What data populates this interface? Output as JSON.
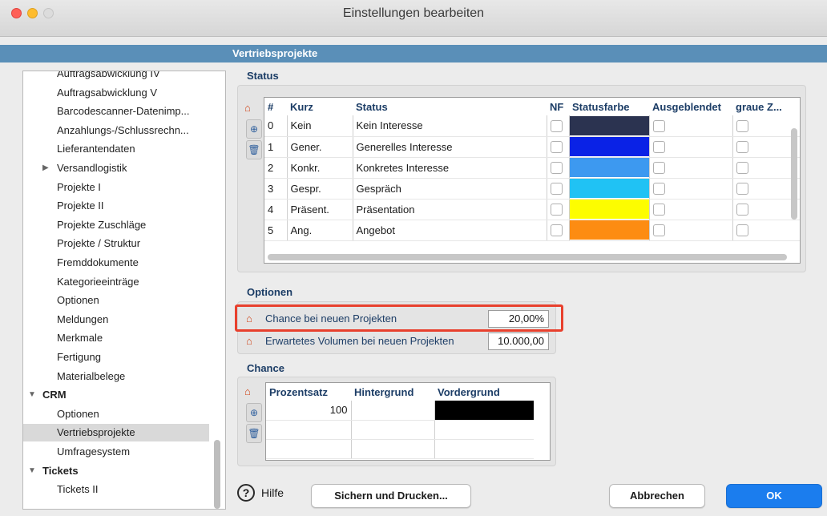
{
  "window": {
    "title": "Einstellungen bearbeiten"
  },
  "section": {
    "title": "Vertriebsprojekte"
  },
  "sidebar": {
    "items": [
      {
        "label": "Auftragsabwicklung IV",
        "kind": "sub"
      },
      {
        "label": "Auftragsabwicklung V",
        "kind": "sub"
      },
      {
        "label": "Barcodescanner-Datenimp...",
        "kind": "sub"
      },
      {
        "label": "Anzahlungs-/Schlussrechn...",
        "kind": "sub"
      },
      {
        "label": "Lieferantendaten",
        "kind": "sub"
      },
      {
        "label": "Versandlogistik",
        "kind": "collapsed"
      },
      {
        "label": "Projekte I",
        "kind": "sub"
      },
      {
        "label": "Projekte II",
        "kind": "sub"
      },
      {
        "label": "Projekte Zuschläge",
        "kind": "sub"
      },
      {
        "label": "Projekte / Struktur",
        "kind": "sub"
      },
      {
        "label": "Fremddokumente",
        "kind": "sub"
      },
      {
        "label": "Kategorieeinträge",
        "kind": "sub"
      },
      {
        "label": "Optionen",
        "kind": "sub"
      },
      {
        "label": "Meldungen",
        "kind": "sub"
      },
      {
        "label": "Merkmale",
        "kind": "sub"
      },
      {
        "label": "Fertigung",
        "kind": "sub"
      },
      {
        "label": "Materialbelege",
        "kind": "sub"
      },
      {
        "label": "CRM",
        "kind": "group"
      },
      {
        "label": "Optionen",
        "kind": "sub"
      },
      {
        "label": "Vertriebsprojekte",
        "kind": "sub",
        "selected": true
      },
      {
        "label": "Umfragesystem",
        "kind": "sub"
      },
      {
        "label": "Tickets",
        "kind": "group"
      },
      {
        "label": "Tickets II",
        "kind": "sub"
      }
    ]
  },
  "status": {
    "group_label": "Status",
    "columns": [
      "#",
      "Kurz",
      "Status",
      "NF",
      "Statusfarbe",
      "Ausgeblendet",
      "graue Z..."
    ],
    "rows": [
      {
        "num": "0",
        "kurz": "Kein",
        "status": "Kein Interesse",
        "color": "#2b3350"
      },
      {
        "num": "1",
        "kurz": "Gener.",
        "status": "Generelles Interesse",
        "color": "#0a22e6"
      },
      {
        "num": "2",
        "kurz": "Konkr.",
        "status": "Konkretes Interesse",
        "color": "#3d99f0"
      },
      {
        "num": "3",
        "kurz": "Gespr.",
        "status": "Gespräch",
        "color": "#20c2f4"
      },
      {
        "num": "4",
        "kurz": "Präsent.",
        "status": "Präsentation",
        "color": "#fdfd00"
      },
      {
        "num": "5",
        "kurz": "Ang.",
        "status": "Angebot",
        "color": "#fd8c12"
      }
    ]
  },
  "options": {
    "group_label": "Optionen",
    "chance_label": "Chance bei neuen Projekten",
    "chance_value": "20,00%",
    "volume_label": "Erwartetes Volumen bei neuen Projekten",
    "volume_value": "10.000,00"
  },
  "chance": {
    "group_label": "Chance",
    "columns": [
      "Prozentsatz",
      "Hintergrund",
      "Vordergrund"
    ],
    "rows": [
      {
        "prozentsatz": "100",
        "hintergrund": "",
        "vordergrund_color": "#000000"
      }
    ]
  },
  "buttons": {
    "help": "Hilfe",
    "save_print": "Sichern und Drucken...",
    "cancel": "Abbrechen",
    "ok": "OK"
  },
  "colors": {
    "accent": "#1b7dee",
    "section_bar": "#5a8fb8",
    "highlight": "#e8402d"
  }
}
